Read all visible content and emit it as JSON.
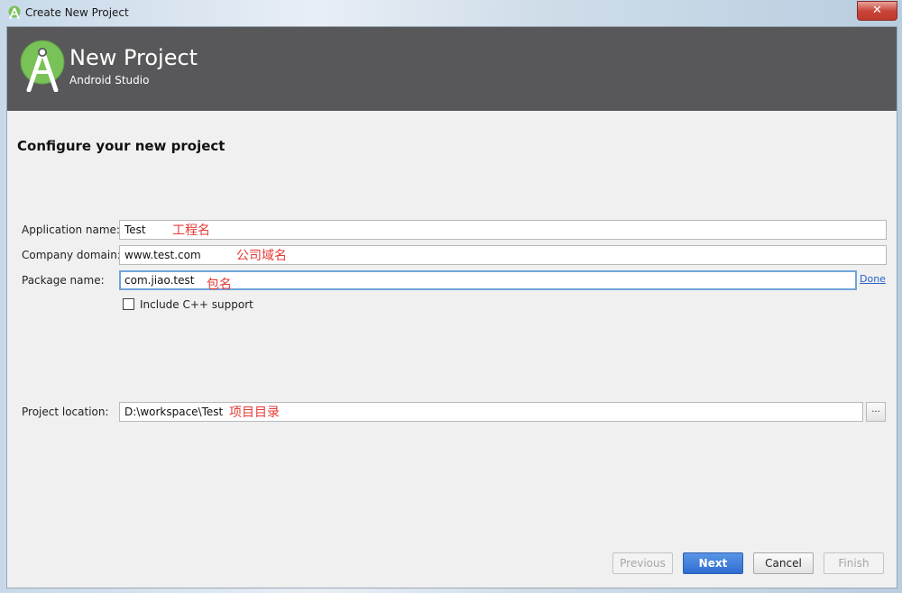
{
  "window": {
    "title": "Create New Project",
    "close_label": "✕"
  },
  "banner": {
    "title": "New Project",
    "subtitle": "Android Studio"
  },
  "form": {
    "section_title": "Configure your new project",
    "app_name": {
      "label": "Application name:",
      "value": "Test",
      "annotation": "工程名"
    },
    "company_domain": {
      "label": "Company domain:",
      "value": "www.test.com",
      "annotation": "公司域名"
    },
    "package_name": {
      "label": "Package name:",
      "value": "com.jiao.test",
      "annotation": "包名",
      "done_label": "Done"
    },
    "include_cpp": {
      "label": "Include C++ support",
      "checked": false
    },
    "project_location": {
      "label": "Project location:",
      "value": "D:\\workspace\\Test",
      "annotation": "项目目录",
      "browse_label": "..."
    }
  },
  "buttons": {
    "previous": "Previous",
    "next": "Next",
    "cancel": "Cancel",
    "finish": "Finish"
  },
  "icons": {
    "window_icon": "android-studio-icon",
    "logo": "android-studio-logo"
  },
  "colors": {
    "banner_bg": "#58585a",
    "primary_button": "#3a78d8",
    "annotation": "#e53935",
    "logo_green": "#78c257"
  }
}
